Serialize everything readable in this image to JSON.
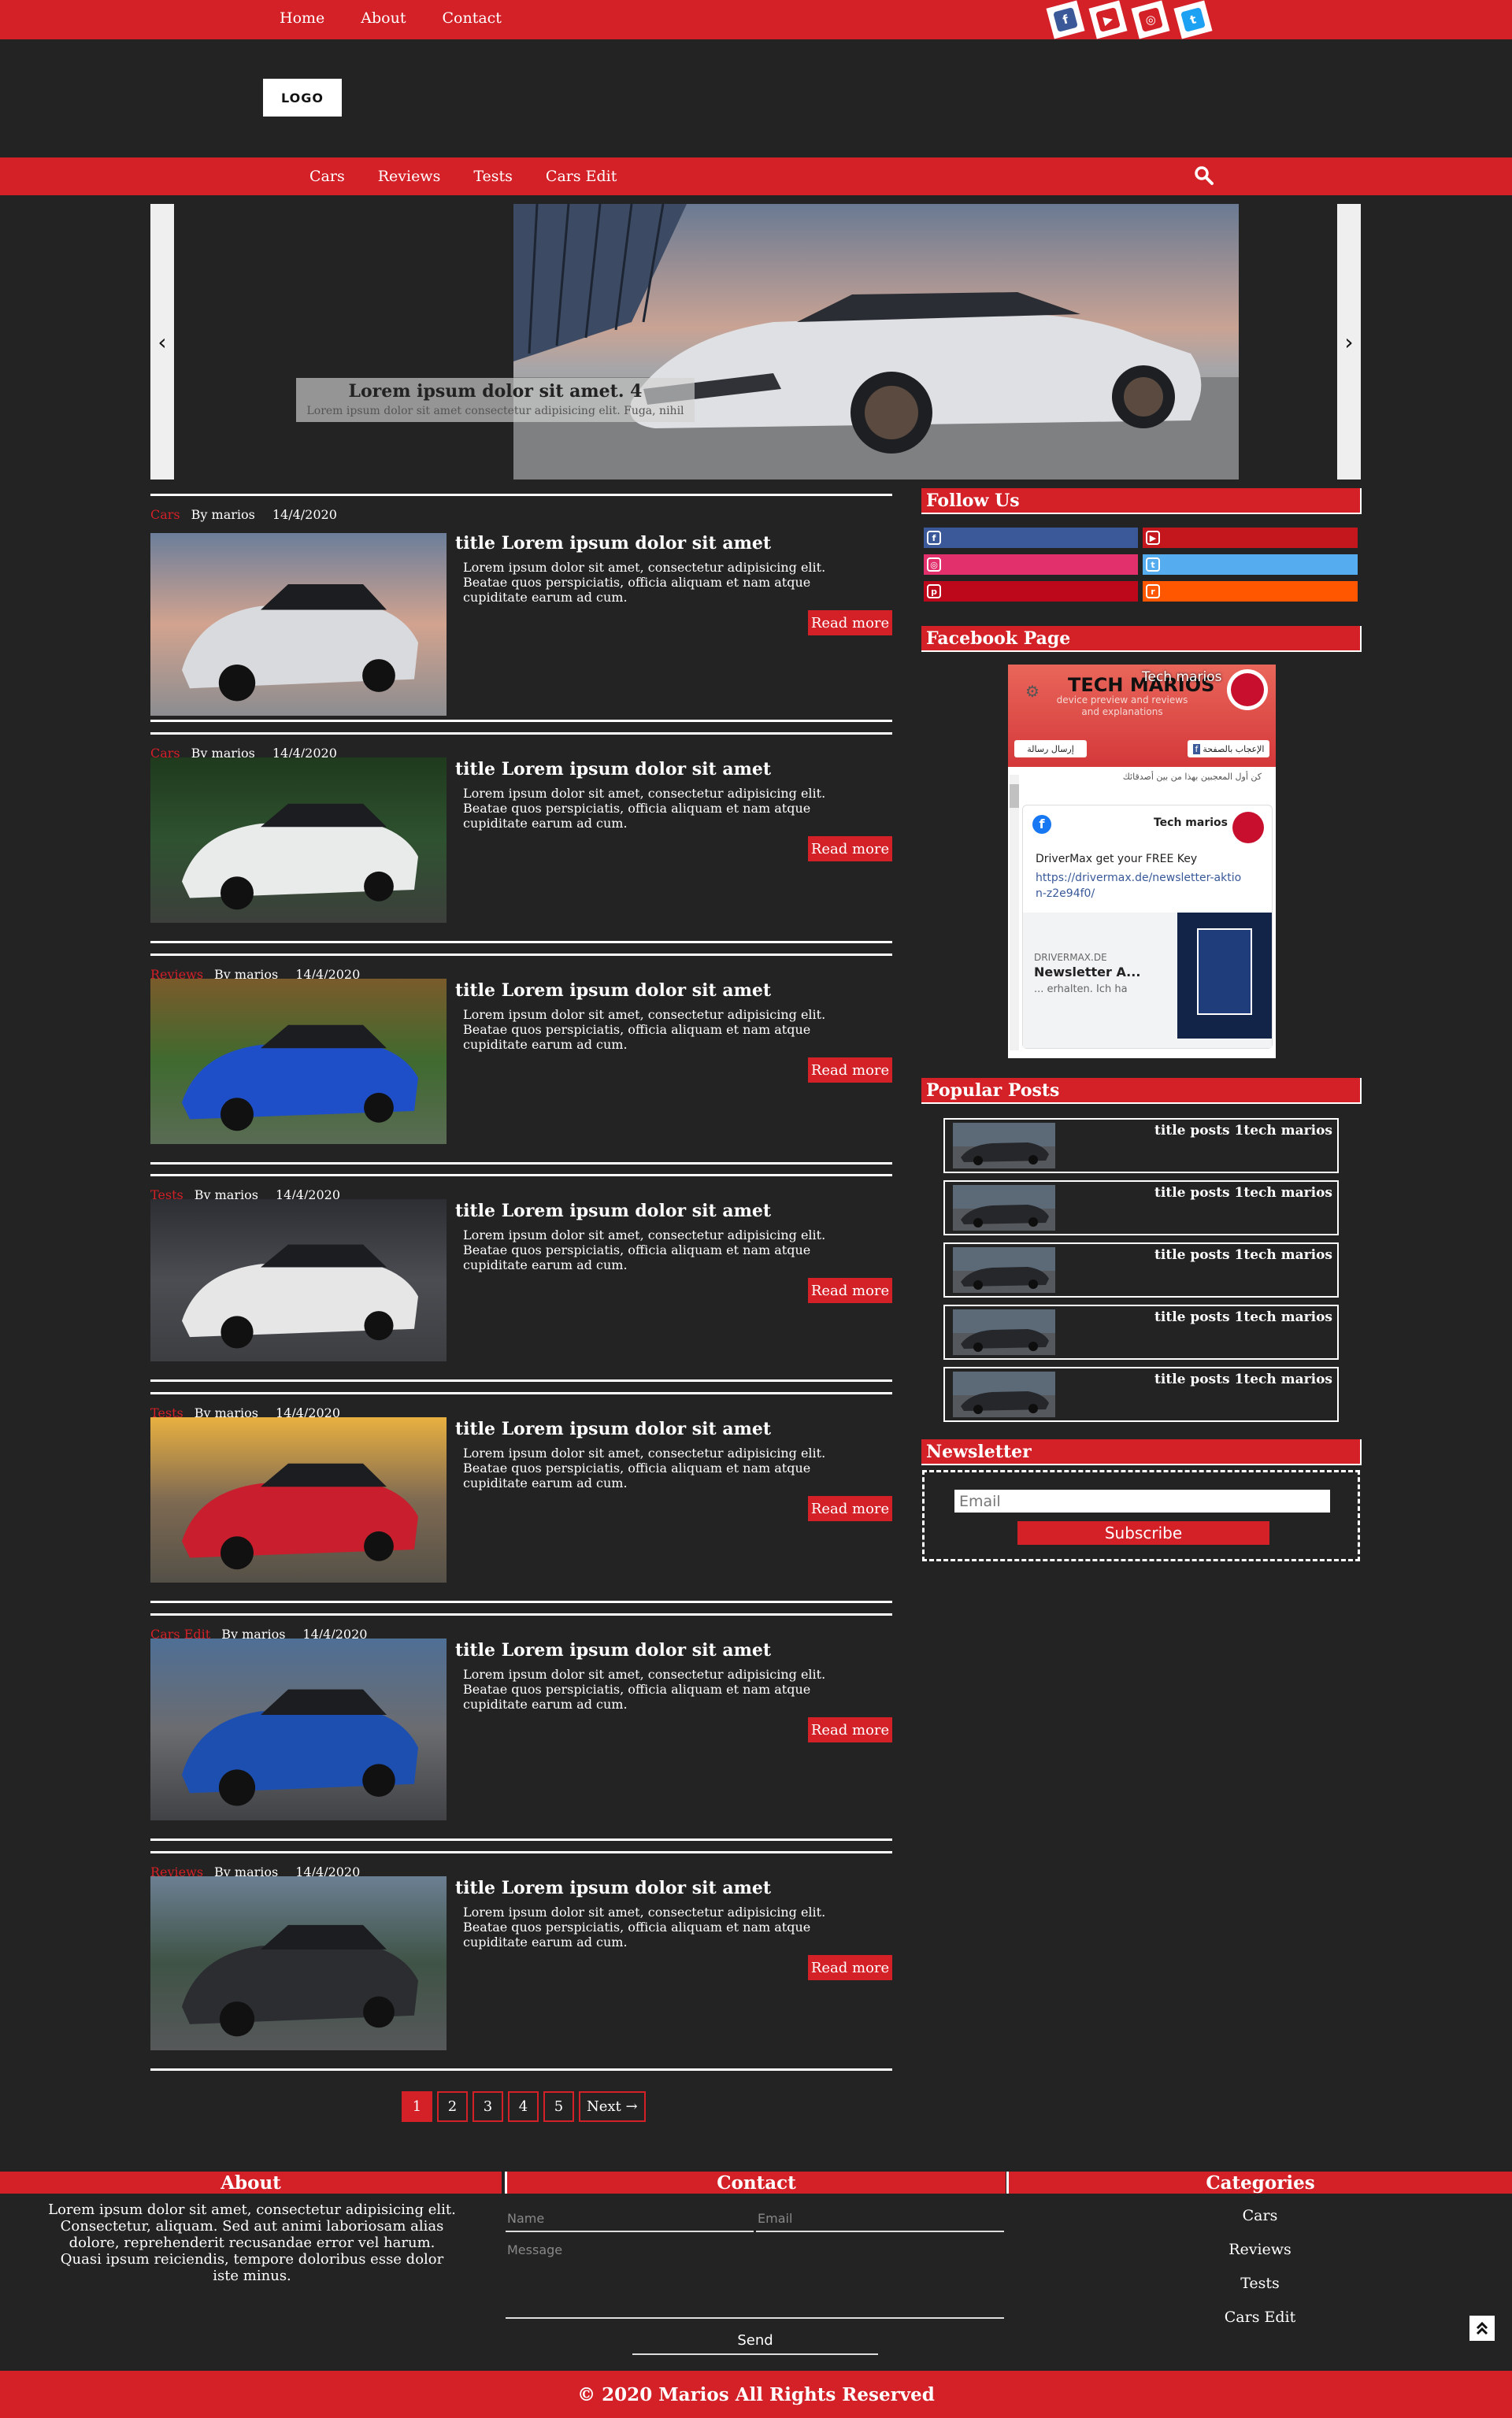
{
  "topnav": {
    "links": [
      "Home",
      "About",
      "Contact"
    ]
  },
  "social_top": [
    {
      "icon": "facebook-icon",
      "glyph": "f",
      "color": "#3b5998"
    },
    {
      "icon": "youtube-icon",
      "glyph": "▶",
      "color": "#d42027"
    },
    {
      "icon": "instagram-icon",
      "glyph": "◎",
      "color": "#d42027"
    },
    {
      "icon": "twitter-icon",
      "glyph": "t",
      "color": "#1da1f2"
    }
  ],
  "logo": "LOGO",
  "mainnav": {
    "links": [
      "Cars",
      "Reviews",
      "Tests",
      "Cars Edit"
    ]
  },
  "slider": {
    "prev": "‹",
    "next": "›",
    "caption_title": "Lorem ipsum dolor sit amet. 4",
    "caption_text": "Lorem ipsum dolor sit amet consectetur adipisicing elit. Fuga, nihil"
  },
  "posts": [
    {
      "category": "Cars",
      "author": "By marios",
      "date": "14/4/2020",
      "title": "title Lorem ipsum dolor sit amet",
      "body": "Lorem ipsum dolor sit amet, consectetur adipisicing elit. Beatae quos perspiciatis, officia aliquam et nam atque cupiditate earum ad cum.",
      "read_more": "Read more",
      "car_color": "#d9dadd",
      "bg": "sunset"
    },
    {
      "category": "Cars",
      "author": "By marios",
      "date": "14/4/2020",
      "title": "title Lorem ipsum dolor sit amet",
      "body": "Lorem ipsum dolor sit amet, consectetur adipisicing elit. Beatae quos perspiciatis, officia aliquam et nam atque cupiditate earum ad cum.",
      "read_more": "Read more",
      "car_color": "#e9eaea",
      "bg": "forest"
    },
    {
      "category": "Reviews",
      "author": "By marios",
      "date": "14/4/2020",
      "title": "title Lorem ipsum dolor sit amet",
      "body": "Lorem ipsum dolor sit amet, consectetur adipisicing elit. Beatae quos perspiciatis, officia aliquam et nam atque cupiditate earum ad cum.",
      "read_more": "Read more",
      "car_color": "#1f4fc8",
      "bg": "park"
    },
    {
      "category": "Tests",
      "author": "By marios",
      "date": "14/4/2020",
      "title": "title Lorem ipsum dolor sit amet",
      "body": "Lorem ipsum dolor sit amet, consectetur adipisicing elit. Beatae quos perspiciatis, officia aliquam et nam atque cupiditate earum ad cum.",
      "read_more": "Read more",
      "car_color": "#e6e6e6",
      "bg": "garage"
    },
    {
      "category": "Tests",
      "author": "By marios",
      "date": "14/4/2020",
      "title": "title Lorem ipsum dolor sit amet",
      "body": "Lorem ipsum dolor sit amet, consectetur adipisicing elit. Beatae quos perspiciatis, officia aliquam et nam atque cupiditate earum ad cum.",
      "read_more": "Read more",
      "car_color": "#c81e2d",
      "bg": "beach"
    },
    {
      "category": "Cars Edit",
      "author": "By marios",
      "date": "14/4/2020",
      "title": "title Lorem ipsum dolor sit amet",
      "body": "Lorem ipsum dolor sit amet, consectetur adipisicing elit. Beatae quos perspiciatis, officia aliquam et nam atque cupiditate earum ad cum.",
      "read_more": "Read more",
      "car_color": "#1d4fb0",
      "bg": "mountain"
    },
    {
      "category": "Reviews",
      "author": "By marios",
      "date": "14/4/2020",
      "title": "title Lorem ipsum dolor sit amet",
      "body": "Lorem ipsum dolor sit amet, consectetur adipisicing elit. Beatae quos perspiciatis, officia aliquam et nam atque cupiditate earum ad cum.",
      "read_more": "Read more",
      "car_color": "#2b2d31",
      "bg": "road"
    }
  ],
  "pagination": {
    "pages": [
      "1",
      "2",
      "3",
      "4",
      "5"
    ],
    "next": "Next →",
    "active": "1"
  },
  "sidebar": {
    "follow_title": "Follow Us",
    "follow_buttons": [
      {
        "icon": "facebook-icon",
        "glyph": "f",
        "color": "#3b5998"
      },
      {
        "icon": "youtube-icon",
        "glyph": "▶",
        "color": "#c4161d"
      },
      {
        "icon": "instagram-icon",
        "glyph": "◎",
        "color": "#e1306c"
      },
      {
        "icon": "twitter-icon",
        "glyph": "t",
        "color": "#55acee"
      },
      {
        "icon": "pinterest-icon",
        "glyph": "p",
        "color": "#bd081c"
      },
      {
        "icon": "reddit-icon",
        "glyph": "r",
        "color": "#ff5700"
      }
    ],
    "facebook_title": "Facebook Page",
    "facebook": {
      "page_name": "Tech marios",
      "cover_title": "TECH MARIOS",
      "cover_sub": "device preview and reviews and explanations",
      "like_btn": "الإعجاب بالصفحة",
      "msg_btn": "إرسال رسالة",
      "followers_note": "كن أول المعجبين بهذا من بين أصدقائك",
      "post_author": "Tech marios",
      "post_text": "DriverMax get your FREE Key",
      "post_link": "https://drivermax.de/newsletter-aktion-z2e94f0/",
      "card_domain": "DRIVERMAX.DE",
      "card_title": "Newsletter A...",
      "card_desc": "... erhalten. Ich ha"
    },
    "popular_title": "Popular Posts",
    "popular": [
      "title posts 1tech marios",
      "title posts 1tech marios",
      "title posts 1tech marios",
      "title posts 1tech marios",
      "title posts 1tech marios"
    ],
    "newsletter_title": "Newsletter",
    "newsletter_placeholder": "Email",
    "subscribe": "Subscribe"
  },
  "footer": {
    "about_title": "About",
    "about_text": "Lorem ipsum dolor sit amet, consectetur adipisicing elit. Consectetur, aliquam. Sed aut animi laboriosam alias dolore, reprehenderit recusandae error vel harum. Quasi ipsum reiciendis, tempore doloribus esse dolor iste minus.",
    "contact_title": "Contact",
    "name_ph": "Name",
    "email_ph": "Email",
    "message_ph": "Message",
    "send": "Send",
    "categories_title": "Categories",
    "categories": [
      "Cars",
      "Reviews",
      "Tests",
      "Cars Edit"
    ],
    "copyright": "© 2020 Marios All Rights Reserved"
  },
  "colors": {
    "accent": "#d42027",
    "background": "#232323"
  }
}
